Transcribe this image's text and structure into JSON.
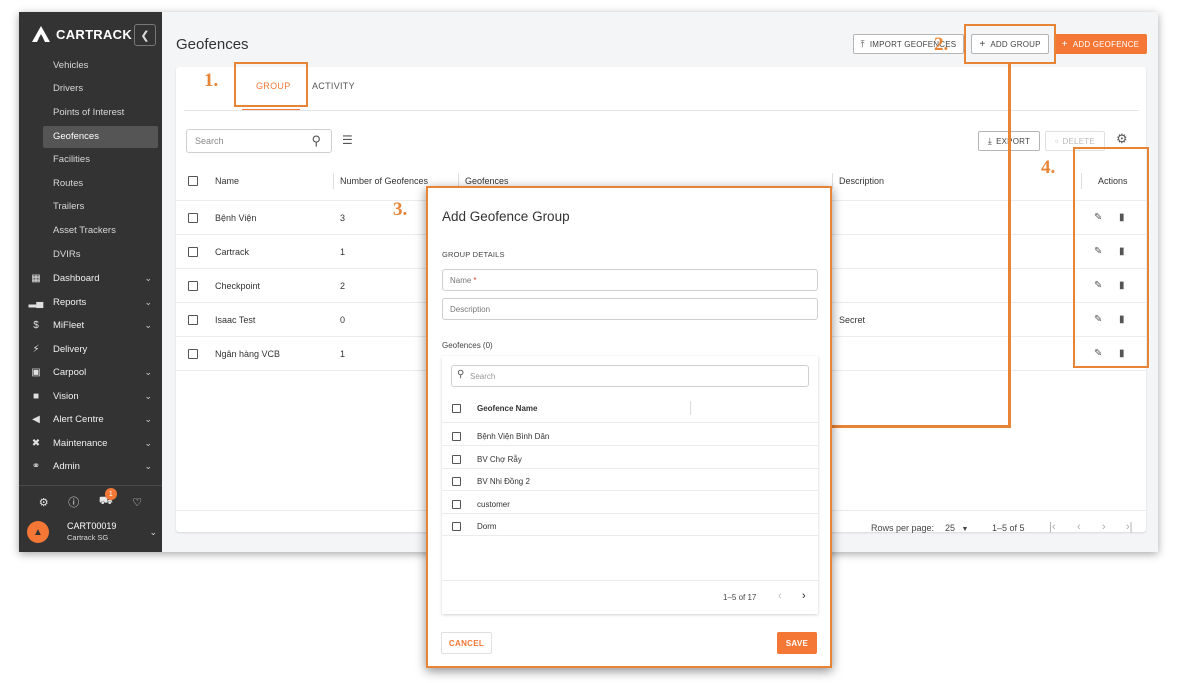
{
  "sidebar": {
    "brand": "CARTRACK",
    "collapse_icon": "chevron-left-icon",
    "sub_items": [
      {
        "label": "Vehicles",
        "active": false
      },
      {
        "label": "Drivers",
        "active": false
      },
      {
        "label": "Points of Interest",
        "active": false
      },
      {
        "label": "Geofences",
        "active": true
      },
      {
        "label": "Facilities",
        "active": false
      },
      {
        "label": "Routes",
        "active": false
      },
      {
        "label": "Trailers",
        "active": false
      },
      {
        "label": "Asset Trackers",
        "active": false
      },
      {
        "label": "DVIRs",
        "active": false
      }
    ],
    "main_items": [
      {
        "label": "Dashboard",
        "icon": "dashboard-icon",
        "chevron": true
      },
      {
        "label": "Reports",
        "icon": "bar-chart-icon",
        "chevron": true
      },
      {
        "label": "MiFleet",
        "icon": "dollar-icon",
        "chevron": true
      },
      {
        "label": "Delivery",
        "icon": "lightning-icon",
        "chevron": false
      },
      {
        "label": "Carpool",
        "icon": "calendar-icon",
        "chevron": true
      },
      {
        "label": "Vision",
        "icon": "camera-icon",
        "chevron": true
      },
      {
        "label": "Alert Centre",
        "icon": "megaphone-icon",
        "chevron": true
      },
      {
        "label": "Maintenance",
        "icon": "wrench-icon",
        "chevron": true
      },
      {
        "label": "Admin",
        "icon": "admin-user-icon",
        "chevron": true
      }
    ],
    "notification_count": "1",
    "account": {
      "id": "CART00019",
      "name": "Cartrack SG"
    }
  },
  "header": {
    "title": "Geofences",
    "import_label": "IMPORT GEOFENCES",
    "add_group_label": "ADD GROUP",
    "add_geofence_label": "ADD GEOFENCE"
  },
  "tabs": [
    {
      "label": "GROUP",
      "active": true
    },
    {
      "label": "ACTIVITY",
      "active": false
    }
  ],
  "toolbar": {
    "search_placeholder": "Search",
    "export_label": "EXPORT",
    "delete_label": "DELETE"
  },
  "table": {
    "columns": [
      "Name",
      "Number of Geofences",
      "Geofences",
      "Description",
      "Actions"
    ],
    "rows": [
      {
        "name": "Bệnh Viện",
        "count": "3",
        "description": ""
      },
      {
        "name": "Cartrack",
        "count": "1",
        "description": ""
      },
      {
        "name": "Checkpoint",
        "count": "2",
        "description": ""
      },
      {
        "name": "Isaac Test",
        "count": "0",
        "description": "Secret"
      },
      {
        "name": "Ngân hàng VCB",
        "count": "1",
        "description": ""
      }
    ],
    "rows_per_page_label": "Rows per page:",
    "rows_per_page": "25",
    "range": "1–5 of 5"
  },
  "dialog": {
    "title": "Add Geofence Group",
    "section": "GROUP DETAILS",
    "name_placeholder": "Name",
    "description_placeholder": "Description",
    "geofences_count_label": "Geofences (0)",
    "search_placeholder": "Search",
    "column": "Geofence Name",
    "items": [
      "Bệnh Viện Bình Dân",
      "BV Chợ Rẫy",
      "BV Nhi Đồng 2",
      "customer",
      "Dorm"
    ],
    "range": "1–5 of 17",
    "cancel_label": "CANCEL",
    "save_label": "SAVE"
  },
  "annotations": [
    "1.",
    "2.",
    "3.",
    "4."
  ],
  "colors": {
    "accent": "#f47735",
    "annotation": "#e88436",
    "sidebar": "#333333"
  }
}
